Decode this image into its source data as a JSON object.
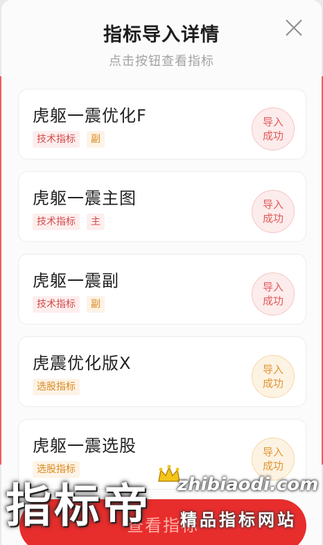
{
  "dialog": {
    "title": "指标导入详情",
    "subtitle": "点击按钮查看指标"
  },
  "indicators": [
    {
      "name": "虎躯一震优化F",
      "tags": [
        "技术指标",
        "副"
      ],
      "status": [
        "导入",
        "成功"
      ]
    },
    {
      "name": "虎躯一震主图",
      "tags": [
        "技术指标",
        "主"
      ],
      "status": [
        "导入",
        "成功"
      ]
    },
    {
      "name": "虎躯一震副",
      "tags": [
        "技术指标",
        "副"
      ],
      "status": [
        "导入",
        "成功"
      ]
    },
    {
      "name": "虎震优化版X",
      "tags": [
        "选股指标"
      ],
      "status": [
        "导入",
        "成功"
      ]
    },
    {
      "name": "虎躯一震选股",
      "tags": [
        "选股指标"
      ],
      "status": [
        "导入",
        "成功"
      ]
    }
  ],
  "bottom_button": {
    "label": "查看指标"
  },
  "watermark": {
    "brand": "指标帝",
    "url": "zhibiaodi.com",
    "tagline": "精品指标网站"
  },
  "colors": {
    "accent_red": "#e82d2d",
    "tag_red": "#d44a4a",
    "tag_orange": "#d98a1f"
  }
}
